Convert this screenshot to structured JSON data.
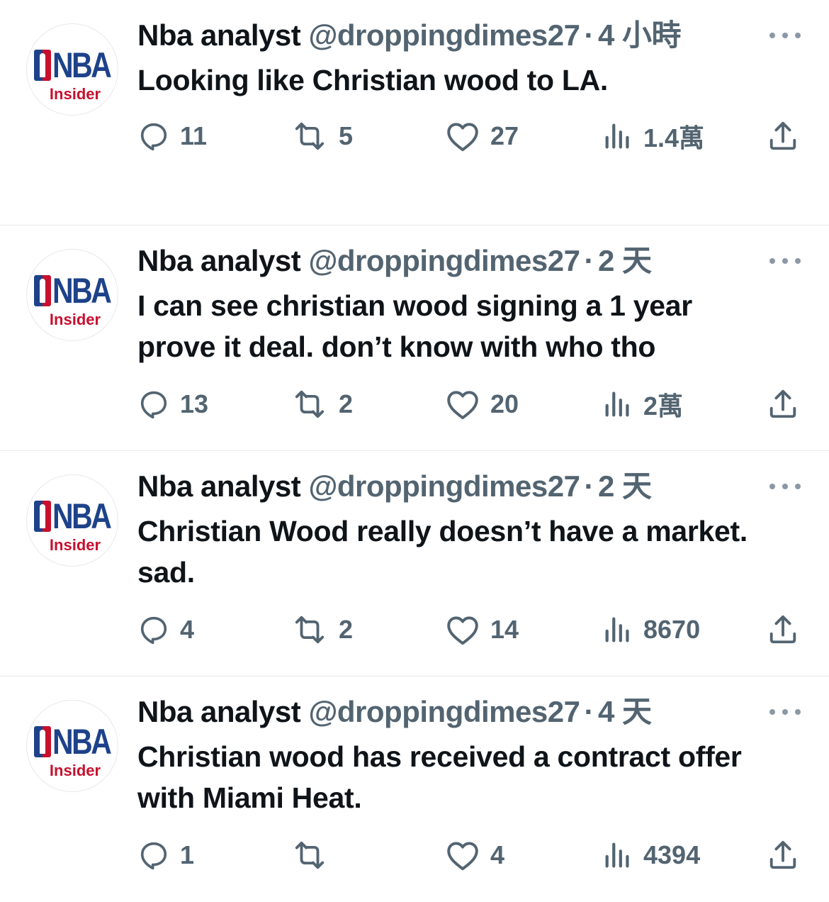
{
  "tweets": [
    {
      "avatar": {
        "logo": "NBA",
        "sub": "Insider"
      },
      "name": "Nba analyst",
      "handle": "@droppingdimes27",
      "separator": "·",
      "time": "4 小時",
      "text": "Looking like Christian wood to LA.",
      "replies": "11",
      "retweets": "5",
      "likes": "27",
      "views": "1.4萬"
    },
    {
      "avatar": {
        "logo": "NBA",
        "sub": "Insider"
      },
      "name": "Nba analyst",
      "handle": "@droppingdimes27",
      "separator": "·",
      "time": "2 天",
      "text": "I can see christian wood signing a 1 year prove it deal. don’t know with who tho",
      "replies": "13",
      "retweets": "2",
      "likes": "20",
      "views": "2萬"
    },
    {
      "avatar": {
        "logo": "NBA",
        "sub": "Insider"
      },
      "name": "Nba analyst",
      "handle": "@droppingdimes27",
      "separator": "·",
      "time": "2 天",
      "text": "Christian Wood really doesn’t have a market. sad.",
      "replies": "4",
      "retweets": "2",
      "likes": "14",
      "views": "8670"
    },
    {
      "avatar": {
        "logo": "NBA",
        "sub": "Insider"
      },
      "name": "Nba analyst",
      "handle": "@droppingdimes27",
      "separator": "·",
      "time": "4 天",
      "text": "Christian wood has received a contract offer with Miami Heat.",
      "replies": "1",
      "retweets": "",
      "likes": "4",
      "views": "4394"
    }
  ],
  "icons": {
    "reply": "reply-icon",
    "retweet": "retweet-icon",
    "like": "heart-icon",
    "views": "views-icon",
    "share": "share-icon",
    "more": "more-icon"
  },
  "colors": {
    "text": "#0f1419",
    "secondary": "#536471",
    "divider": "#e6e9ec",
    "nba_blue": "#1d428a",
    "nba_red": "#c8102e"
  }
}
